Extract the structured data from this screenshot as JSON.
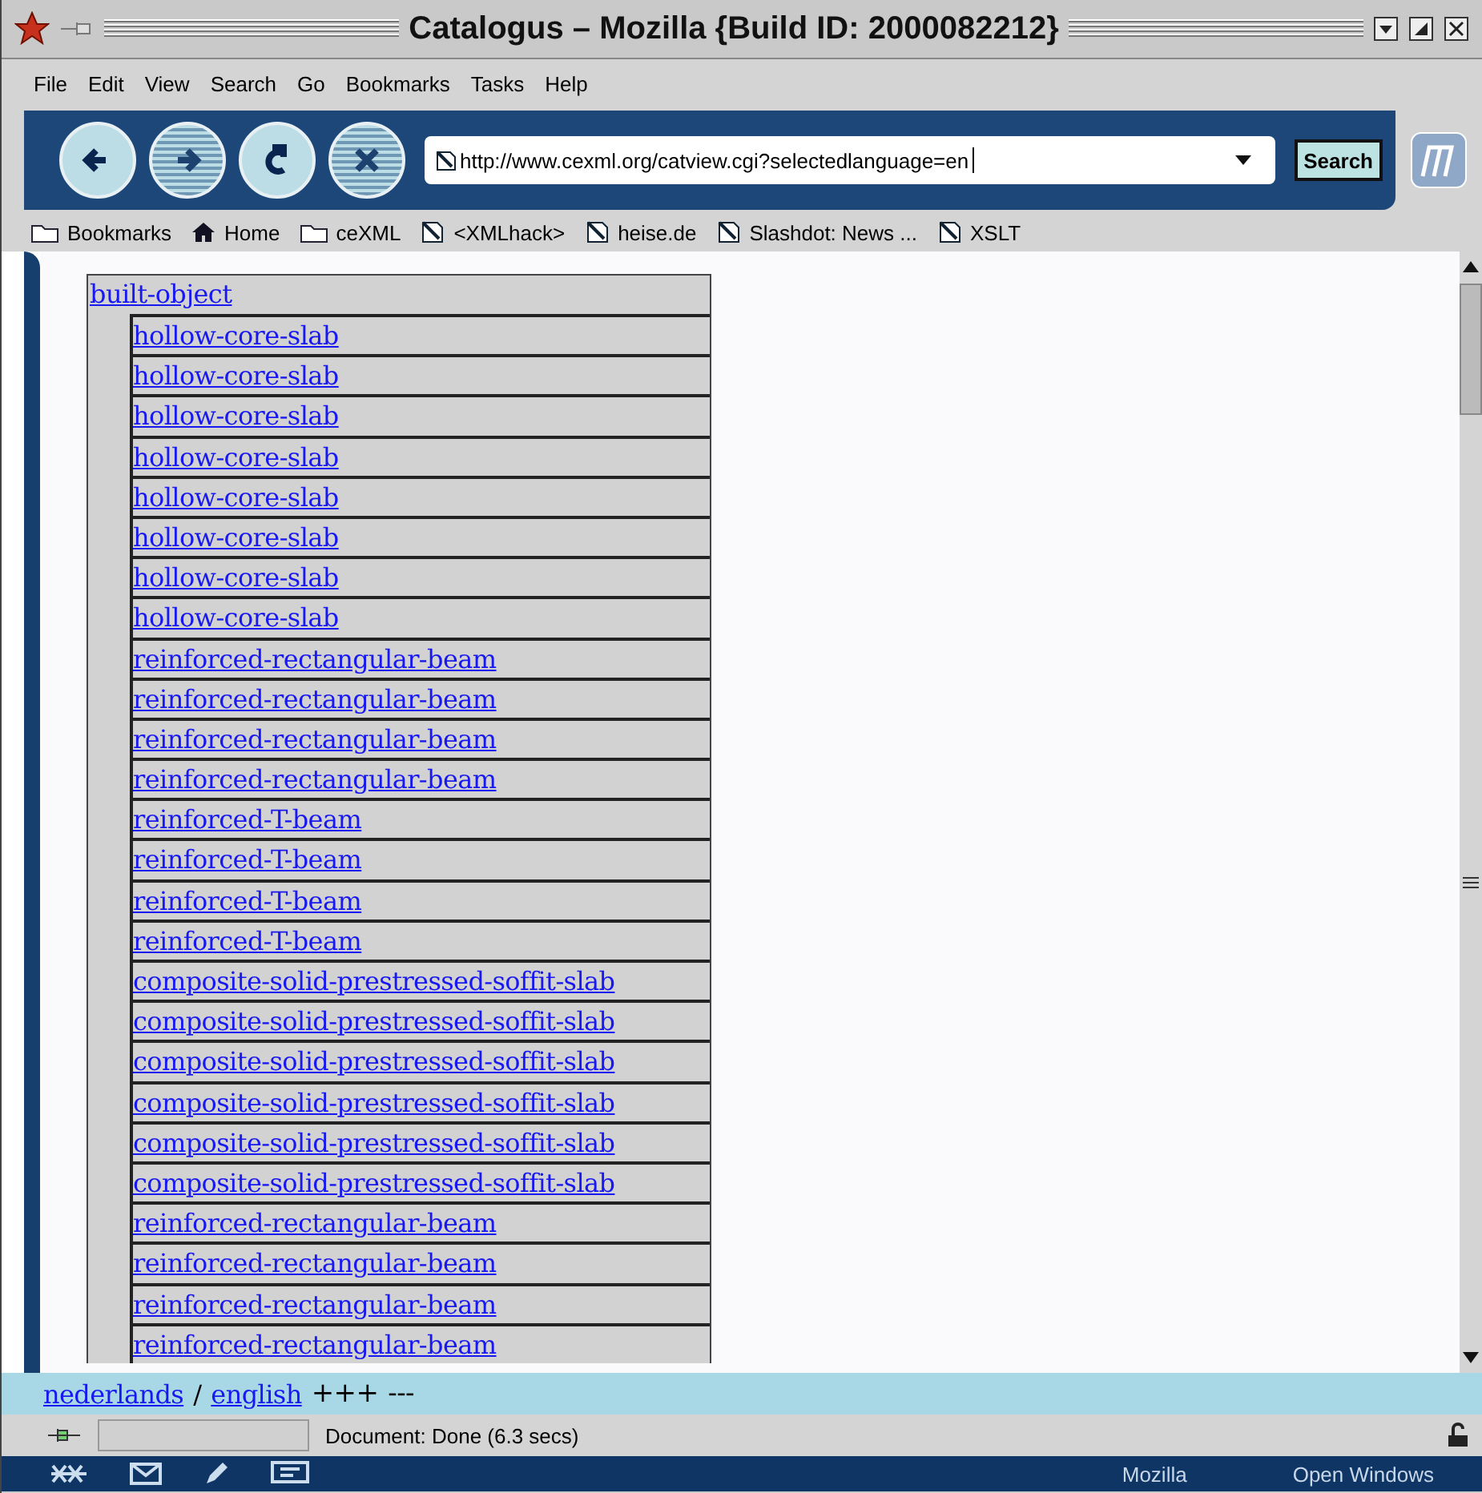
{
  "window": {
    "title": "Catalogus – Mozilla {Build ID: 2000082212}"
  },
  "menu": [
    "File",
    "Edit",
    "View",
    "Search",
    "Go",
    "Bookmarks",
    "Tasks",
    "Help"
  ],
  "navigation": {
    "buttons": [
      {
        "kind": "back",
        "disabled": false
      },
      {
        "kind": "forward",
        "disabled": true
      },
      {
        "kind": "reload",
        "disabled": false
      },
      {
        "kind": "stop",
        "disabled": true
      }
    ],
    "url": "http://www.cexml.org/catview.cgi?selectedlanguage=en",
    "search_button": "Search"
  },
  "bookmarks": [
    {
      "kind": "folder",
      "label": "Bookmarks"
    },
    {
      "kind": "home",
      "label": "Home"
    },
    {
      "kind": "folder",
      "label": "ceXML"
    },
    {
      "kind": "page",
      "label": "<XMLhack>"
    },
    {
      "kind": "page",
      "label": "heise.de"
    },
    {
      "kind": "page",
      "label": "Slashdot: News ..."
    },
    {
      "kind": "page",
      "label": "XSLT"
    }
  ],
  "tree": {
    "label": "built-object",
    "children": [
      {
        "label": "hollow-core-slab"
      },
      {
        "label": "hollow-core-slab"
      },
      {
        "label": "hollow-core-slab"
      },
      {
        "label": "hollow-core-slab"
      },
      {
        "label": "hollow-core-slab"
      },
      {
        "label": "hollow-core-slab"
      },
      {
        "label": "hollow-core-slab"
      },
      {
        "label": "hollow-core-slab"
      },
      {
        "label": "reinforced-rectangular-beam"
      },
      {
        "label": "reinforced-rectangular-beam"
      },
      {
        "label": "reinforced-rectangular-beam"
      },
      {
        "label": "reinforced-rectangular-beam"
      },
      {
        "label": "reinforced-T-beam"
      },
      {
        "label": "reinforced-T-beam"
      },
      {
        "label": "reinforced-T-beam"
      },
      {
        "label": "reinforced-T-beam"
      },
      {
        "label": "composite-solid-prestressed-soffit-slab"
      },
      {
        "label": "composite-solid-prestressed-soffit-slab"
      },
      {
        "label": "composite-solid-prestressed-soffit-slab"
      },
      {
        "label": "composite-solid-prestressed-soffit-slab"
      },
      {
        "label": "composite-solid-prestressed-soffit-slab"
      },
      {
        "label": "composite-solid-prestressed-soffit-slab"
      },
      {
        "label": "reinforced-rectangular-beam"
      },
      {
        "label": "reinforced-rectangular-beam"
      },
      {
        "label": "reinforced-rectangular-beam"
      },
      {
        "label": "reinforced-rectangular-beam"
      }
    ]
  },
  "language_bar": {
    "languages": [
      {
        "label": "nederlands"
      },
      {
        "label": "english"
      }
    ],
    "separator": "/",
    "expand": "+++",
    "collapse": "---"
  },
  "status_bar": {
    "text": "Document: Done (6.3 secs)"
  },
  "taskbar": {
    "items": [
      "Mozilla",
      "Open Windows"
    ]
  }
}
